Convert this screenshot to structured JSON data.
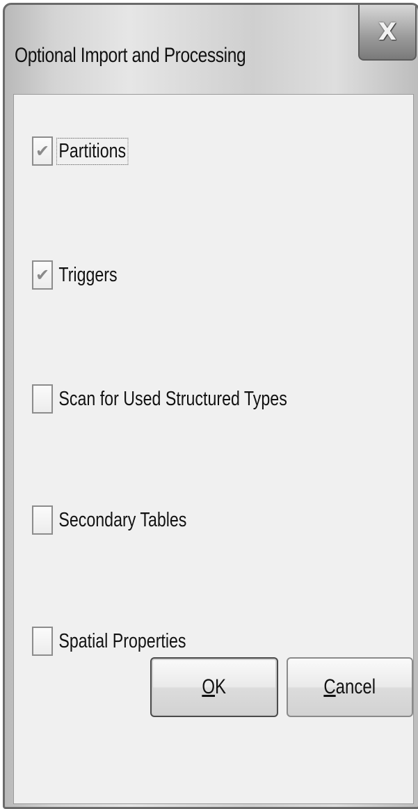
{
  "dialog": {
    "title": "Optional Import and Processing",
    "close_glyph": "X"
  },
  "options": [
    {
      "label": "Partitions",
      "checked": true
    },
    {
      "label": "Triggers",
      "checked": true
    },
    {
      "label": "Scan for Used Structured Types",
      "checked": false
    },
    {
      "label": "Secondary Tables",
      "checked": false
    },
    {
      "label": "Spatial Properties",
      "checked": false
    }
  ],
  "buttons": {
    "ok": {
      "mnemonic": "O",
      "rest": "K"
    },
    "cancel": {
      "mnemonic": "C",
      "rest": "ancel"
    }
  },
  "check_glyph": "✔"
}
